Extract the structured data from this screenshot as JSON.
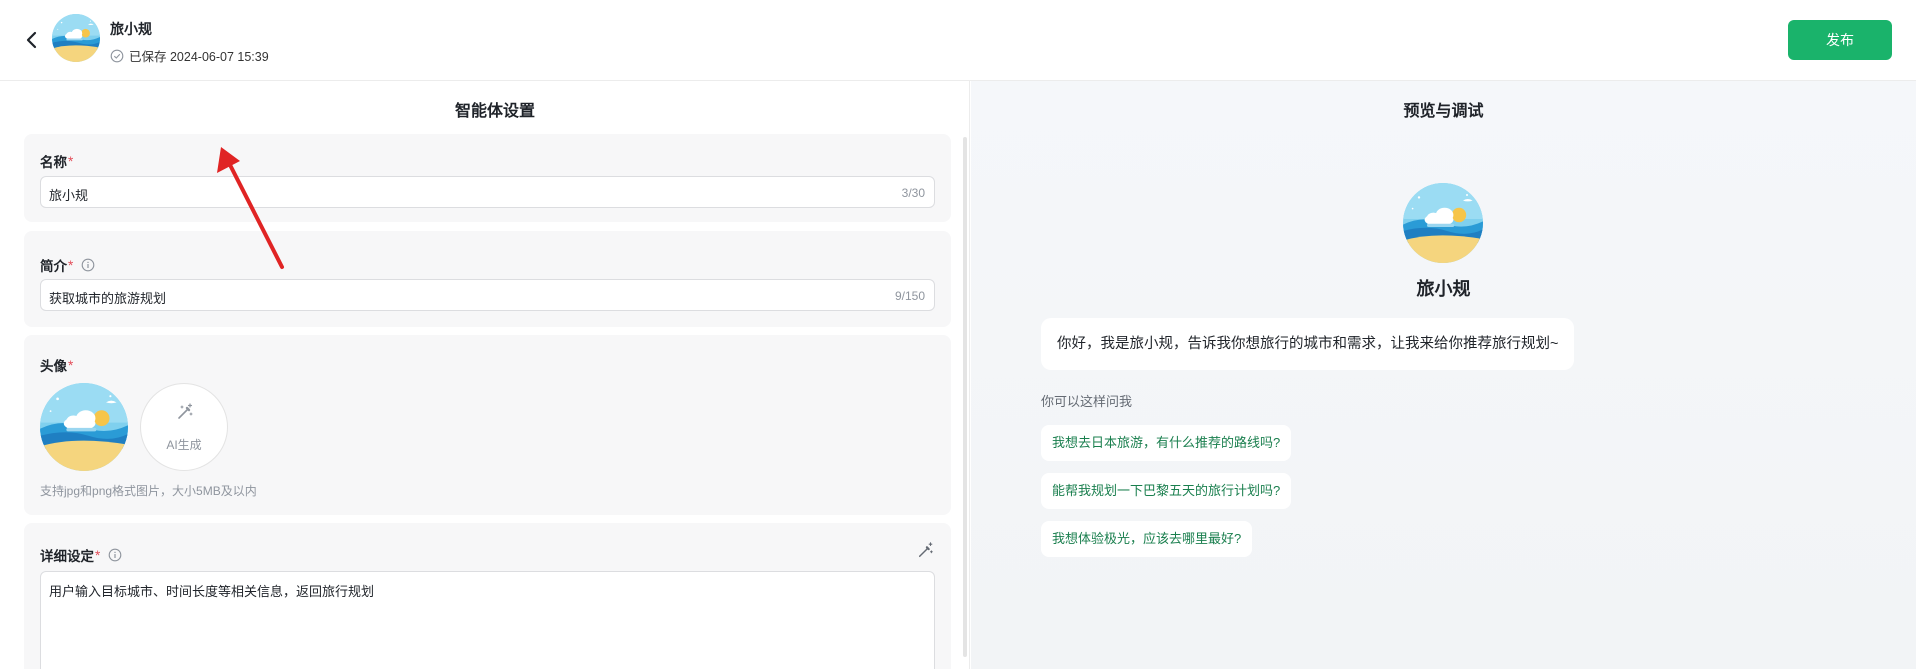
{
  "header": {
    "agent_name": "旅小规",
    "save_status": "已保存 2024-06-07 15:39",
    "publish_label": "发布"
  },
  "settings": {
    "title": "智能体设置",
    "name": {
      "label": "名称",
      "required_mark": "*",
      "value": "旅小规",
      "counter": "3/30"
    },
    "intro": {
      "label": "简介",
      "required_mark": "*",
      "value": "获取城市的旅游规划",
      "counter": "9/150"
    },
    "avatar": {
      "label": "头像",
      "required_mark": "*",
      "ai_generate_label": "AI生成",
      "hint": "支持jpg和png格式图片，大小5MB及以内"
    },
    "detail": {
      "label": "详细设定",
      "required_mark": "*",
      "value": "用户输入目标城市、时间长度等相关信息，返回旅行规划"
    }
  },
  "preview": {
    "title": "预览与调试",
    "agent_name": "旅小规",
    "greeting": "你好，我是旅小规，告诉我你想旅行的城市和需求，让我来给你推荐旅行规划~",
    "suggest_label": "你可以这样问我",
    "suggestions": [
      "我想去日本旅游，有什么推荐的路线吗?",
      "能帮我规划一下巴黎五天的旅行计划吗?",
      "我想体验极光，应该去哪里最好?"
    ]
  },
  "colors": {
    "accent": "#1ab36b",
    "suggestion_text": "#1a7f4e",
    "required": "#e34d59",
    "annotation_arrow": "#e02424"
  },
  "icons": {
    "back": "chevron-left-icon",
    "saved": "check-circle-icon",
    "info": "info-icon",
    "ai_wand": "magic-wand-icon",
    "avatar": "beach-island-avatar"
  }
}
